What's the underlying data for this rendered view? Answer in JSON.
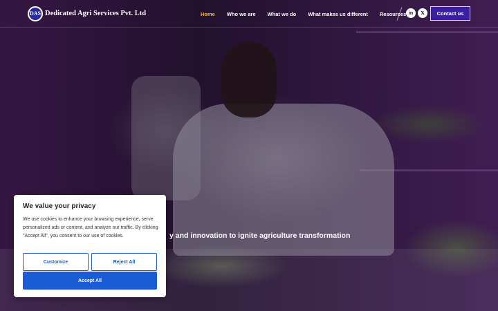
{
  "brand": {
    "badge": "DAS",
    "name": "Dedicated Agri Services Pvt. Ltd"
  },
  "nav": {
    "items": [
      {
        "label": "Home",
        "active": true
      },
      {
        "label": "Who we are"
      },
      {
        "label": "What we do"
      },
      {
        "label": "What makes us different"
      },
      {
        "label": "Resources"
      }
    ],
    "resources_caret": "▾",
    "social": [
      {
        "icon": "linkedin-icon",
        "glyph": "in"
      },
      {
        "icon": "x-icon",
        "glyph": "𝕏"
      }
    ],
    "contact_label": "Contact us"
  },
  "hero": {
    "tagline": "y and innovation to ignite agriculture transformation"
  },
  "cookie": {
    "title": "We value your privacy",
    "body": "We use cookies to enhance your browsing experience, serve personalized ads or content, and analyze our traffic. By clicking \"Accept All\", you consent to our use of cookies.",
    "customize_label": "Customize",
    "reject_label": "Reject All",
    "accept_label": "Accept All"
  },
  "colors": {
    "accent": "#3a1fa0",
    "active_nav": "#f5b94a",
    "cookie_button": "#1a5bd6"
  }
}
